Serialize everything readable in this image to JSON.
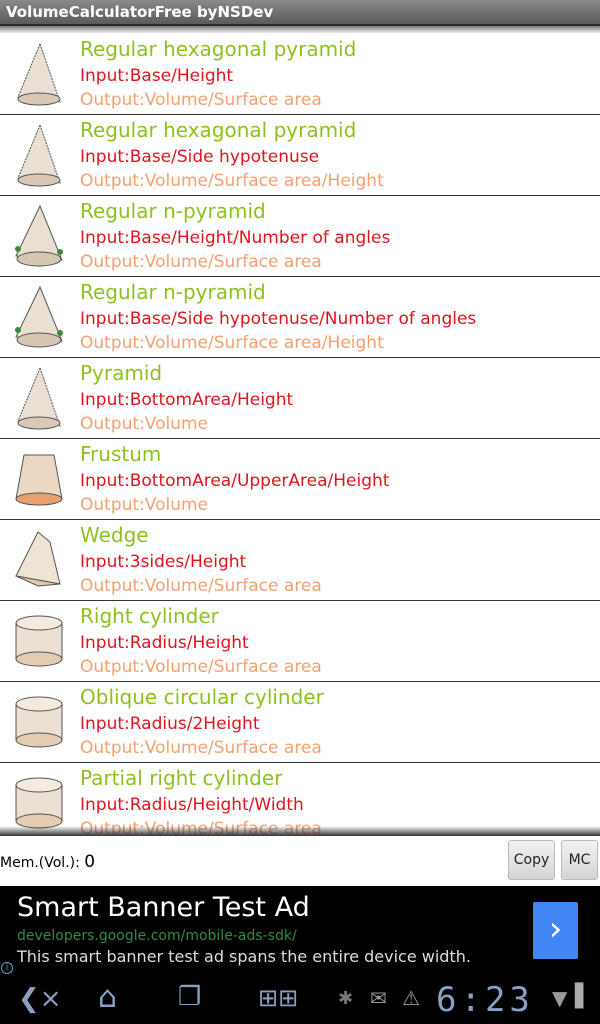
{
  "app": {
    "title": "VolumeCalculatorFree byNSDev"
  },
  "items": [
    {
      "title": "Regular hexagonal pyramid",
      "input": "Input:Base/Height",
      "output": "Output:Volume/Surface area",
      "icon": "pyramid-icon"
    },
    {
      "title": "Regular hexagonal pyramid",
      "input": "Input:Base/Side hypotenuse",
      "output": "Output:Volume/Surface area/Height",
      "icon": "pyramid-icon"
    },
    {
      "title": "Regular n-pyramid",
      "input": "Input:Base/Height/Number of angles",
      "output": "Output:Volume/Surface area",
      "icon": "n-pyramid-icon"
    },
    {
      "title": "Regular n-pyramid",
      "input": "Input:Base/Side hypotenuse/Number of angles",
      "output": "Output:Volume/Surface area/Height",
      "icon": "n-pyramid-icon"
    },
    {
      "title": "Pyramid",
      "input": "Input:BottomArea/Height",
      "output": "Output:Volume",
      "icon": "pyramid-icon"
    },
    {
      "title": "Frustum",
      "input": "Input:BottomArea/UpperArea/Height",
      "output": "Output:Volume",
      "icon": "frustum-icon"
    },
    {
      "title": "Wedge",
      "input": "Input:3sides/Height",
      "output": "Output:Volume/Surface area",
      "icon": "wedge-icon"
    },
    {
      "title": "Right cylinder",
      "input": "Input:Radius/Height",
      "output": "Output:Volume/Surface area",
      "icon": "cylinder-icon"
    },
    {
      "title": "Oblique circular cylinder",
      "input": "Input:Radius/2Height",
      "output": "Output:Volume/Surface area",
      "icon": "cylinder-icon"
    },
    {
      "title": "Partial right cylinder",
      "input": "Input:Radius/Height/Width",
      "output": "Output:Volume/Surface area",
      "icon": "cylinder-icon"
    }
  ],
  "memory": {
    "label": "Mem.(Vol.):",
    "value": "0",
    "copy": "Copy",
    "mc": "MC"
  },
  "ad": {
    "headline": "Smart Banner Test Ad",
    "url": "developers.google.com/mobile-ads-sdk/",
    "description": "This smart banner test ad spans the entire device width.",
    "info": "i"
  },
  "status": {
    "time": "6:23"
  },
  "colors": {
    "title": "#8cc21e",
    "input": "#e0141e",
    "output": "#f5a070",
    "ad_button": "#4285f4"
  }
}
